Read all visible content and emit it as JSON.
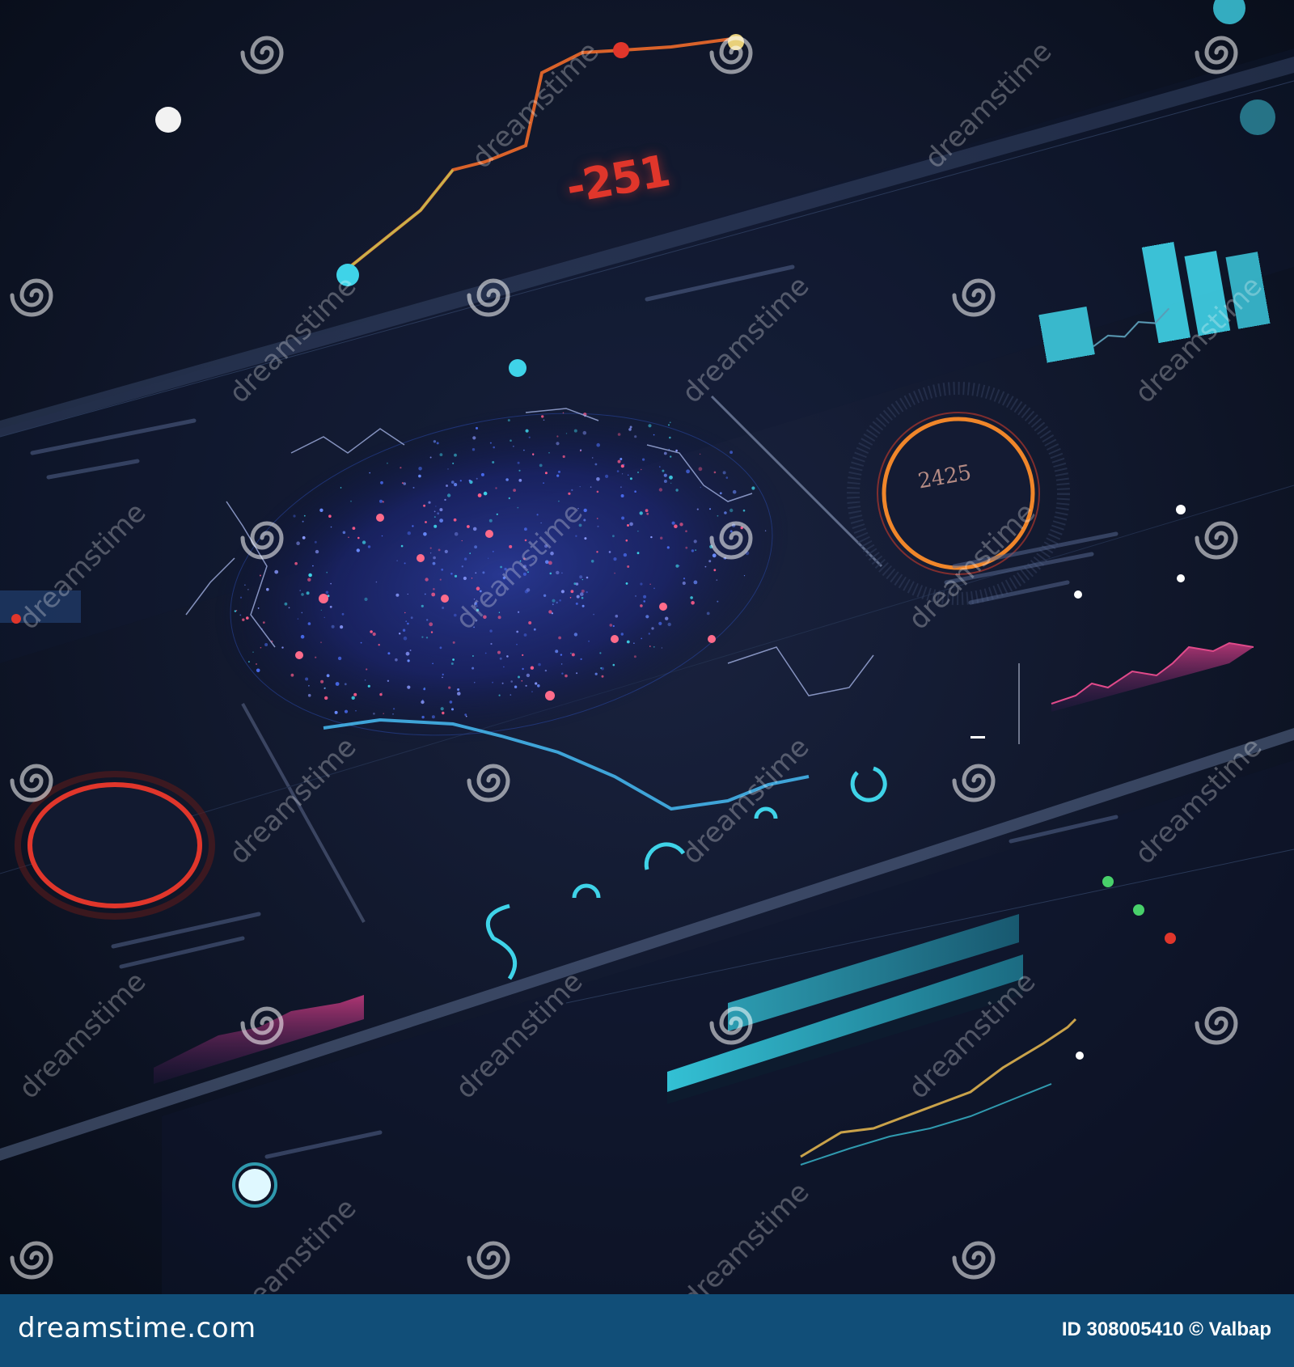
{
  "dashboard": {
    "metric_value": "-251",
    "gauge_value": "2425"
  },
  "watermark": {
    "text": "dreamstime"
  },
  "footer": {
    "brand": "dreamstime.com",
    "image_id": "ID 308005410 © Valbap"
  },
  "colors": {
    "background": "#0b1322",
    "accent_cyan": "#3fd3e8",
    "accent_red": "#e0362b",
    "accent_orange": "#f0862a",
    "footer_bar": "#114e78"
  }
}
